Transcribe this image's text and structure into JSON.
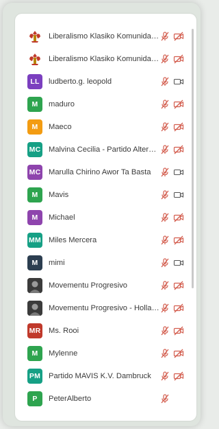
{
  "participants": [
    {
      "name": "Liberalismo Klasiko Komunidat ...",
      "avatar": {
        "type": "logo"
      },
      "mic": "muted",
      "video": "off"
    },
    {
      "name": "Liberalismo Klasiko Komunidat ...",
      "avatar": {
        "type": "logo"
      },
      "mic": "muted",
      "video": "off"
    },
    {
      "name": "ludberto.g. leopold",
      "avatar": {
        "type": "initials",
        "initials": "LL",
        "color": "#7b3fbf"
      },
      "mic": "muted",
      "video": "on"
    },
    {
      "name": "maduro",
      "avatar": {
        "type": "initials",
        "initials": "M",
        "color": "#2ea44f"
      },
      "mic": "muted",
      "video": "off"
    },
    {
      "name": "Maeco",
      "avatar": {
        "type": "initials",
        "initials": "M",
        "color": "#f39c12"
      },
      "mic": "muted",
      "video": "off"
    },
    {
      "name": "Malvina Cecilia - Partido Alterna...",
      "avatar": {
        "type": "initials",
        "initials": "MC",
        "color": "#16a085"
      },
      "mic": "muted",
      "video": "off"
    },
    {
      "name": "Marulla Chirino Awor Ta Basta",
      "avatar": {
        "type": "initials",
        "initials": "MC",
        "color": "#8e44ad"
      },
      "mic": "muted",
      "video": "on"
    },
    {
      "name": "Mavis",
      "avatar": {
        "type": "initials",
        "initials": "M",
        "color": "#2ea44f"
      },
      "mic": "muted",
      "video": "on"
    },
    {
      "name": "Michael",
      "avatar": {
        "type": "initials",
        "initials": "M",
        "color": "#8e44ad"
      },
      "mic": "muted",
      "video": "off"
    },
    {
      "name": "Miles Mercera",
      "avatar": {
        "type": "initials",
        "initials": "MM",
        "color": "#16a085"
      },
      "mic": "muted",
      "video": "off"
    },
    {
      "name": "mimi",
      "avatar": {
        "type": "initials",
        "initials": "M",
        "color": "#2c3e50"
      },
      "mic": "muted",
      "video": "on"
    },
    {
      "name": "Movementu Progresivo",
      "avatar": {
        "type": "photo"
      },
      "mic": "muted",
      "video": "off"
    },
    {
      "name": "Movementu Progresivo - Hollan...",
      "avatar": {
        "type": "photo"
      },
      "mic": "muted",
      "video": "off"
    },
    {
      "name": "Ms. Rooi",
      "avatar": {
        "type": "initials",
        "initials": "MR",
        "color": "#c0392b"
      },
      "mic": "muted",
      "video": "off"
    },
    {
      "name": "Mylenne",
      "avatar": {
        "type": "initials",
        "initials": "M",
        "color": "#2ea44f"
      },
      "mic": "muted",
      "video": "off"
    },
    {
      "name": "Partido MAVIS K.V. Dambruck",
      "avatar": {
        "type": "initials",
        "initials": "PM",
        "color": "#16a085"
      },
      "mic": "muted",
      "video": "off"
    },
    {
      "name": "PeterAlberto",
      "avatar": {
        "type": "initials",
        "initials": "P",
        "color": "#2ea44f"
      },
      "mic": "muted",
      "video": null
    }
  ],
  "colors": {
    "muted_icon": "#d35d4e",
    "video_on_icon": "#555555",
    "text": "#3a3a3a"
  }
}
